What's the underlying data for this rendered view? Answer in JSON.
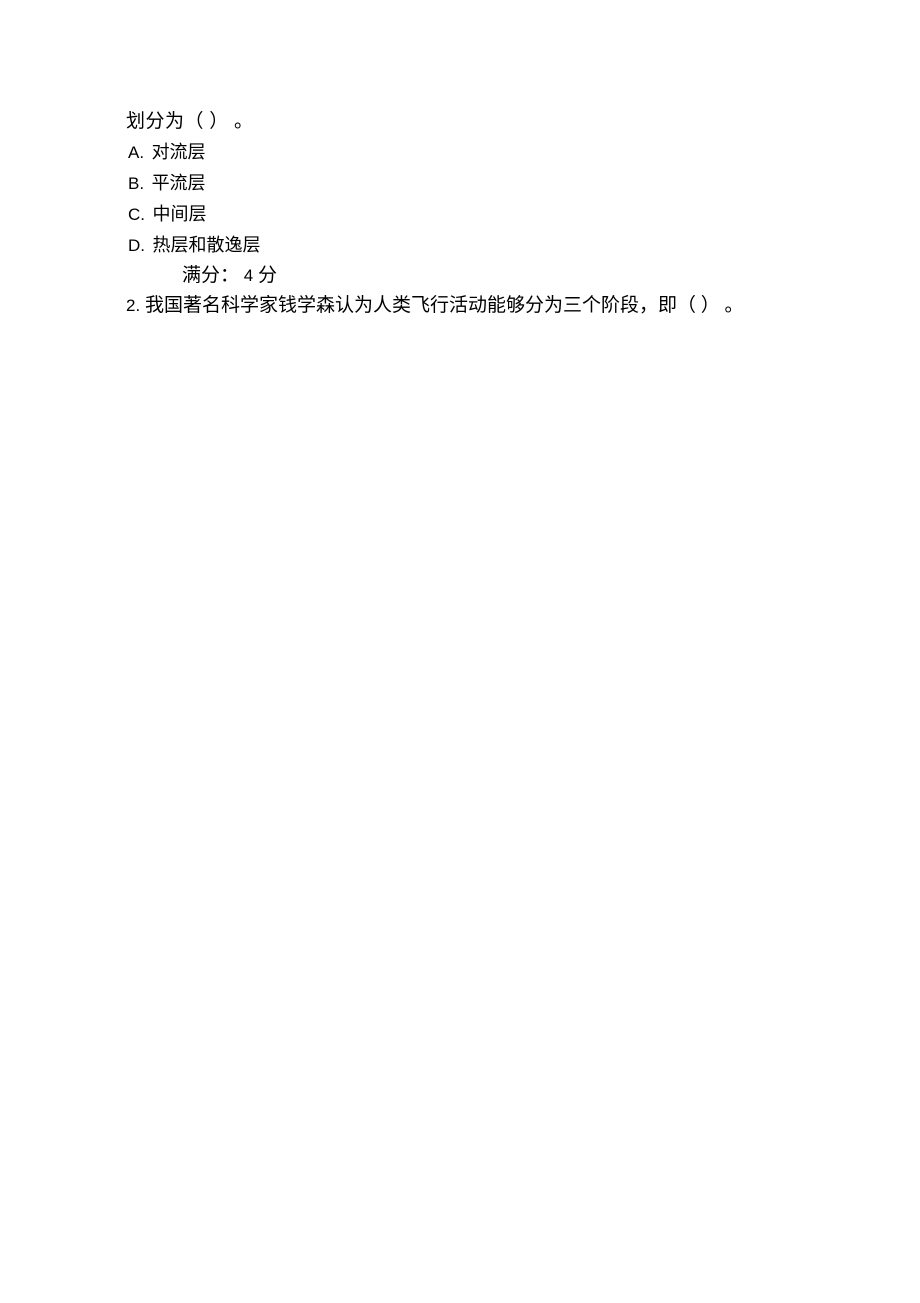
{
  "q1": {
    "stem": "划分为（ ） 。",
    "options": {
      "A": {
        "letter": "A.",
        "text": "对流层"
      },
      "B": {
        "letter": "B.",
        "text": "平流层"
      },
      "C": {
        "letter": "C.",
        "text": "中间层"
      },
      "D": {
        "letter": "D.",
        "text": "热层和散逸层"
      }
    },
    "score": {
      "label": "满分：",
      "value": "4",
      "unit": "分"
    }
  },
  "q2": {
    "number": "2.",
    "text": "我国著名科学家钱学森认为人类飞行活动能够分为三个阶段，即（ ） 。"
  }
}
